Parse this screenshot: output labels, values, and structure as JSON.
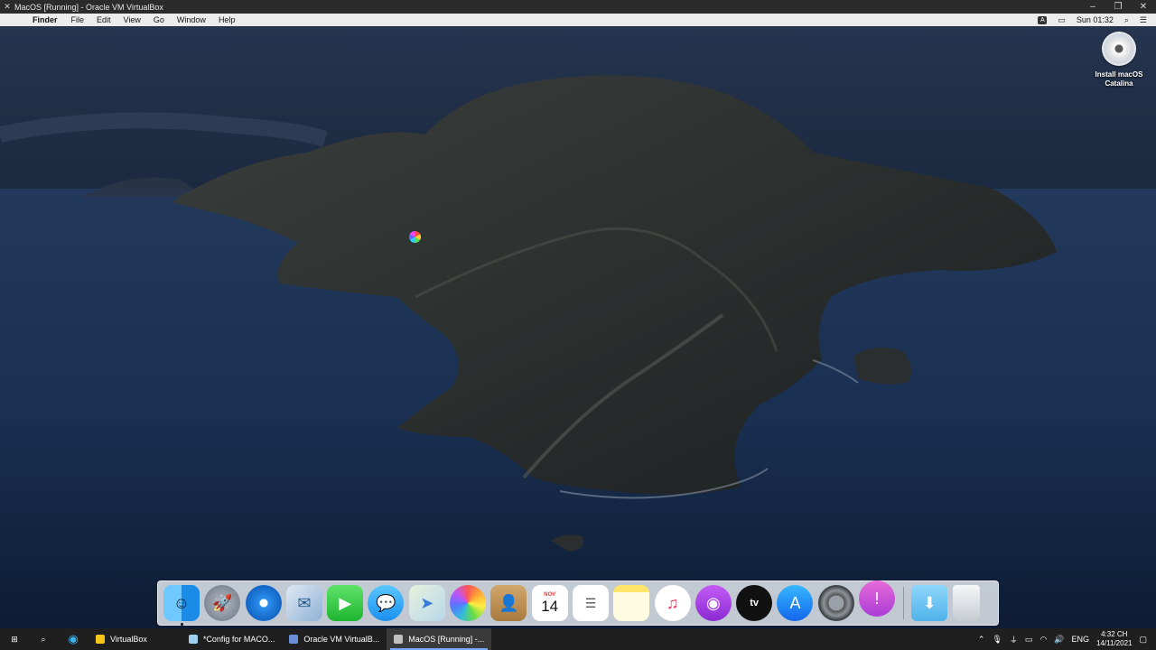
{
  "vbox": {
    "title": "MacOS [Running] - Oracle VM VirtualBox",
    "minimize_icon": "minimize-icon",
    "restore_icon": "restore-icon",
    "close_icon": "close-icon"
  },
  "menubar": {
    "apple_icon": "",
    "items": [
      "Finder",
      "File",
      "Edit",
      "View",
      "Go",
      "Window",
      "Help"
    ],
    "keyboard_badge": "A",
    "clock": "Sun 01:32"
  },
  "desktop": {
    "icon_label": "Install macOS Catalina"
  },
  "dock": {
    "apps": [
      "Finder",
      "Launchpad",
      "Safari",
      "Mail",
      "FaceTime",
      "Messages",
      "Maps",
      "Photos",
      "Contacts",
      "Calendar",
      "Reminders",
      "Notes",
      "Music",
      "Podcasts",
      "TV",
      "App Store",
      "System Preferences",
      "Feedback Assistant"
    ],
    "calendar_month": "NOV",
    "calendar_day": "14",
    "appletv_label": "tv"
  },
  "taskbar": {
    "apps": [
      {
        "label": "VirtualBox",
        "color": "#f5c518"
      },
      {
        "label": "*Config for MACO...",
        "color": "#9fd0f0"
      },
      {
        "label": "Oracle VM VirtualB...",
        "color": "#6b8fd6"
      },
      {
        "label": "MacOS [Running] -...",
        "color": "#c0c0c0"
      }
    ],
    "lang": "ENG",
    "time": "4:32 CH",
    "date": "14/11/2021"
  }
}
